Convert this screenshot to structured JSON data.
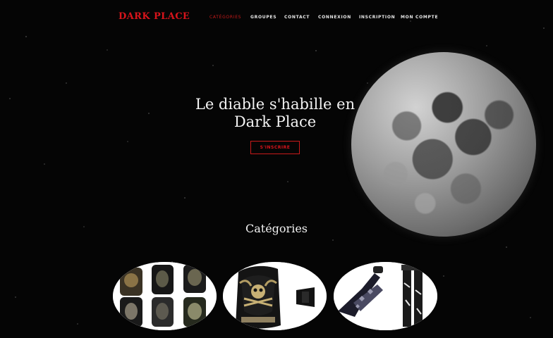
{
  "brand": "DARK PLACE",
  "nav": {
    "items": [
      {
        "label": "CATÉGORIES",
        "active": true
      },
      {
        "label": "GROUPES",
        "active": false
      },
      {
        "label": "CONTACT",
        "active": false
      },
      {
        "label": "CONNEXION",
        "active": false
      },
      {
        "label": "INSCRIPTION",
        "active": false
      },
      {
        "label": "MON COMPTE",
        "active": false
      }
    ]
  },
  "hero": {
    "title_line1": "Le diable s'habille en",
    "title_line2": "Dark Place",
    "cta_label": "S'INSCRIRE"
  },
  "categories": {
    "title": "Catégories",
    "cards": [
      {
        "image": "phone-cases-collage"
      },
      {
        "image": "corset-skull"
      },
      {
        "image": "tights-legs"
      }
    ]
  },
  "colors": {
    "brand": "#d8141b",
    "background": "#050505",
    "text": "#f2f2f2"
  }
}
